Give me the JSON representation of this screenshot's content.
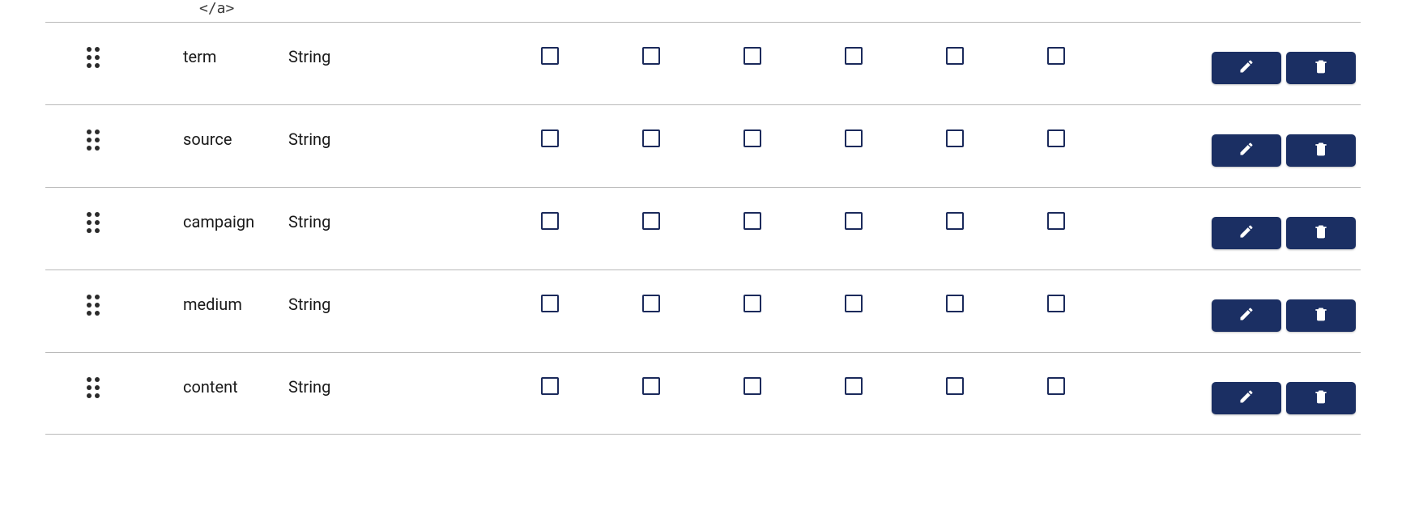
{
  "fragment_text": "</a>",
  "colors": {
    "checkbox_border": "#1b2a5b",
    "button_bg": "#1b2f63",
    "button_fg": "#ffffff",
    "row_border": "#b9b9b9"
  },
  "icons": {
    "drag_handle": "drag-handle-icon",
    "edit": "pencil-icon",
    "delete": "trash-icon"
  },
  "rows": [
    {
      "name": "term",
      "type": "String",
      "checks": [
        false,
        false,
        false,
        false,
        false,
        false
      ]
    },
    {
      "name": "source",
      "type": "String",
      "checks": [
        false,
        false,
        false,
        false,
        false,
        false
      ]
    },
    {
      "name": "campaign",
      "type": "String",
      "checks": [
        false,
        false,
        false,
        false,
        false,
        false
      ]
    },
    {
      "name": "medium",
      "type": "String",
      "checks": [
        false,
        false,
        false,
        false,
        false,
        false
      ]
    },
    {
      "name": "content",
      "type": "String",
      "checks": [
        false,
        false,
        false,
        false,
        false,
        false
      ]
    }
  ]
}
